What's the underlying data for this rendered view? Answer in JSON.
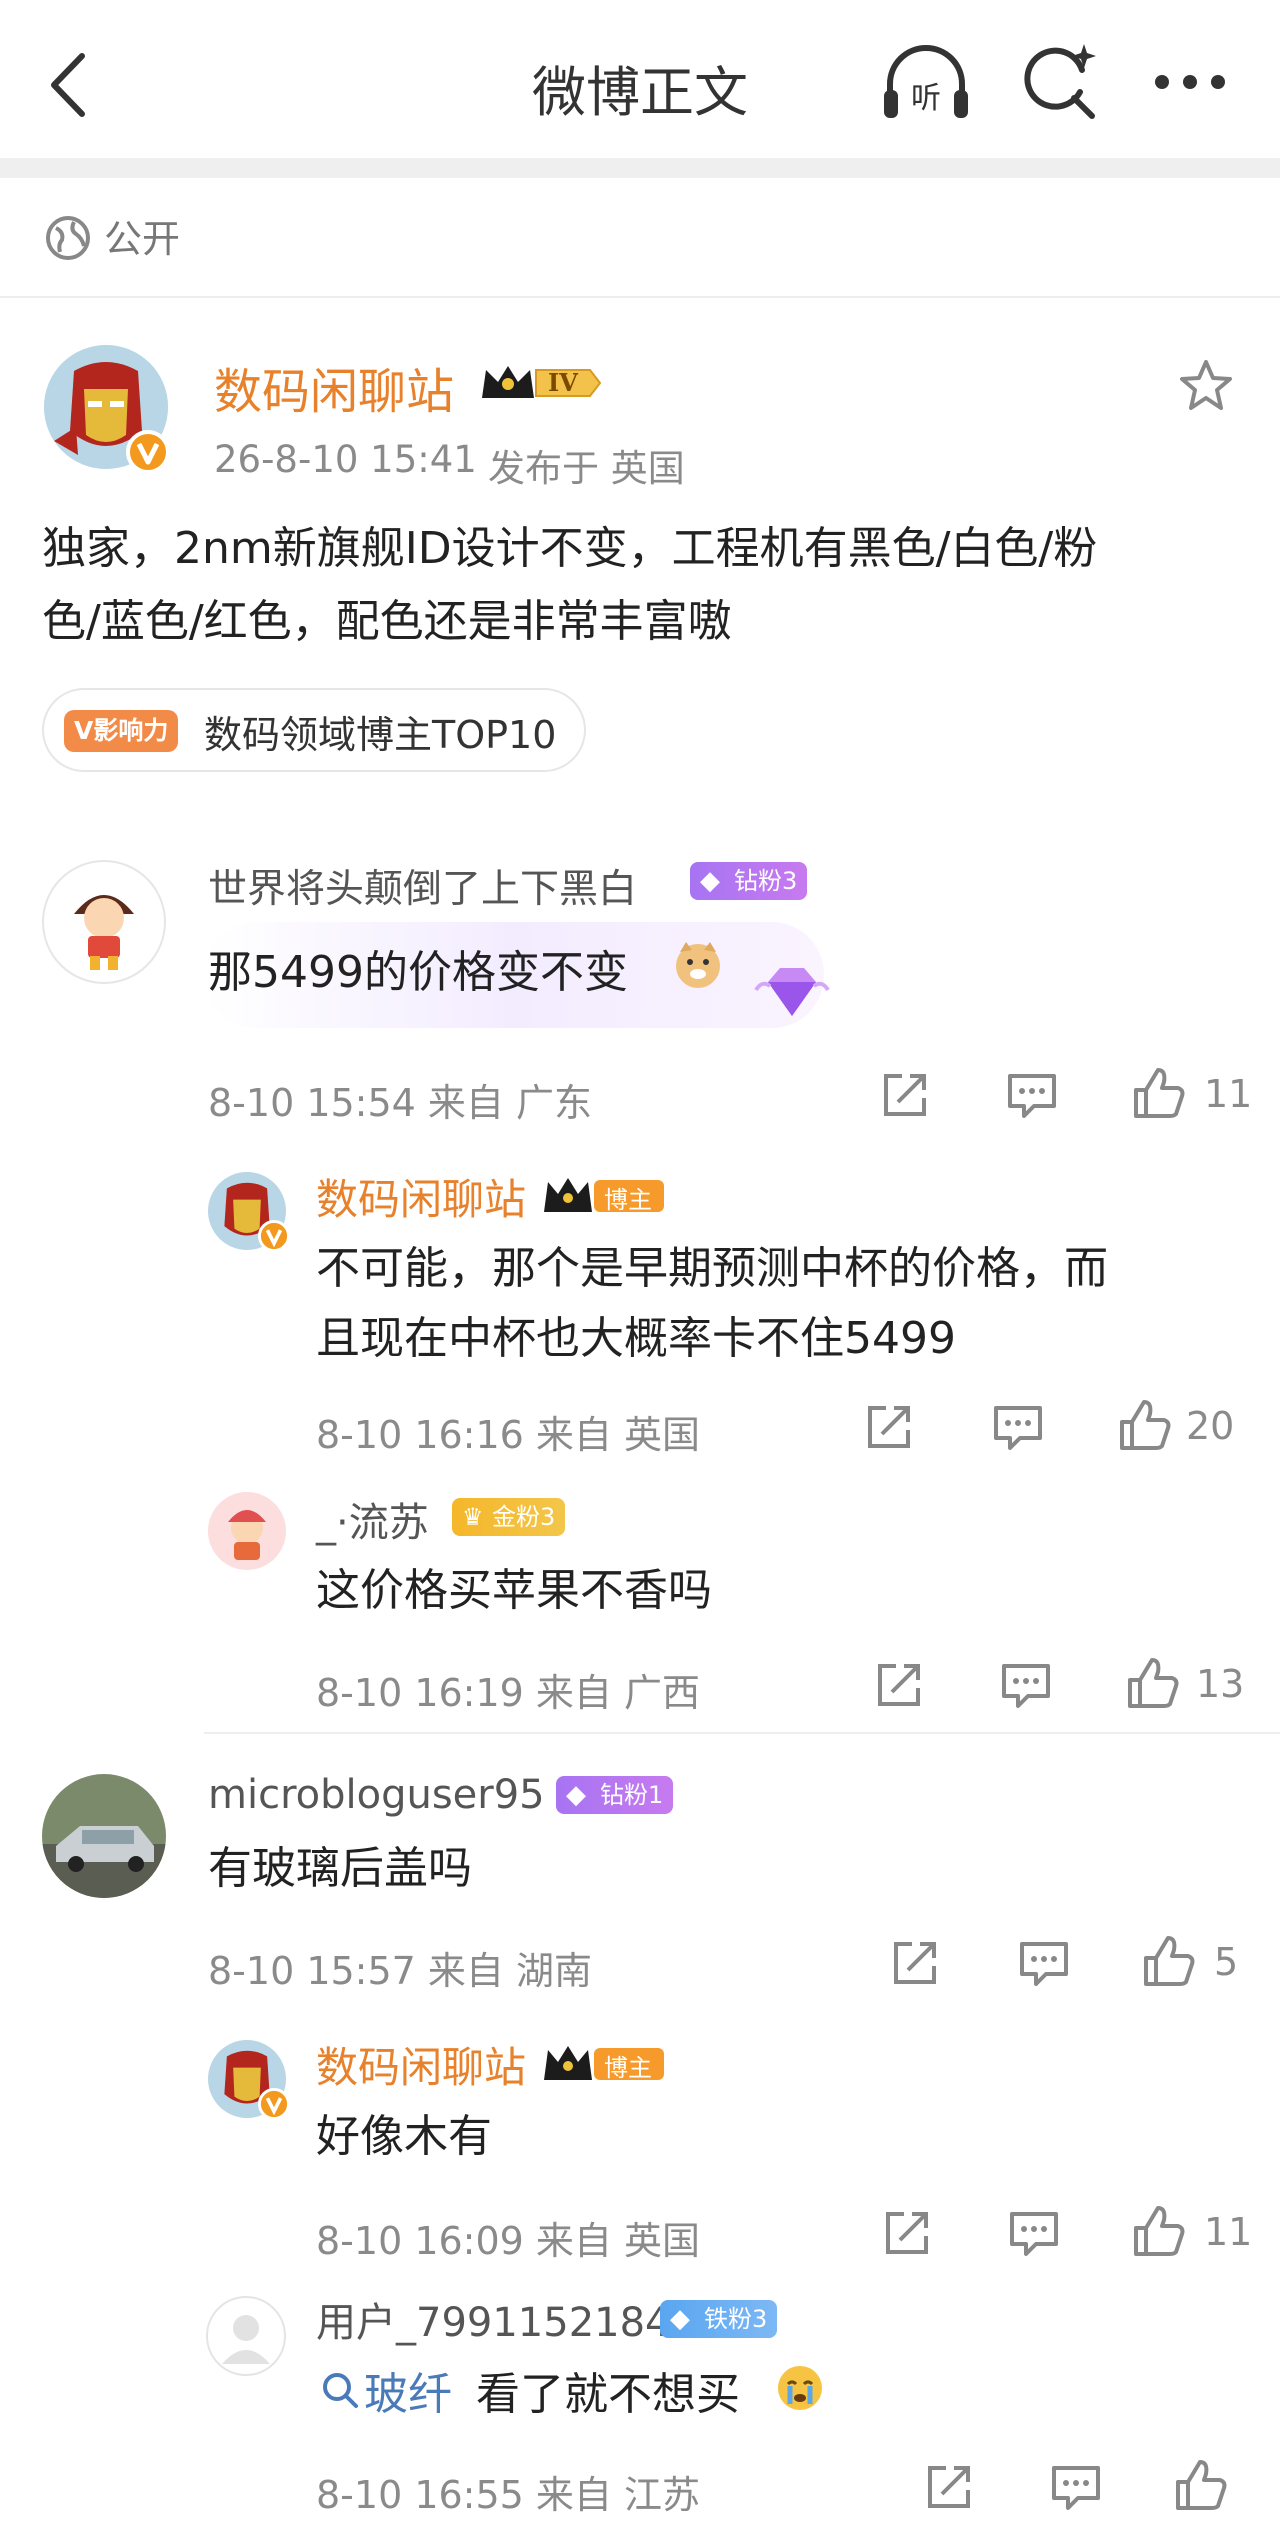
{
  "header": {
    "title": "微博正文"
  },
  "visibility": {
    "label": "公开"
  },
  "post": {
    "author": "数码闲聊站",
    "level_badge": "IV",
    "time": "26-8-10 15:41",
    "location": "发布于 英国",
    "content_line1": "独家，2nm新旗舰ID设计不变，工程机有黑色/白色/粉",
    "content_line2": "色/蓝色/红色，配色还是非常丰富嗷",
    "influence_badge": "V影响力",
    "influence_text": "数码领域博主TOP10"
  },
  "comments": [
    {
      "user": "世界将头颠倒了上下黑白",
      "badge": "钻粉3",
      "text": "那5499的价格变不变",
      "time": "8-10 15:54 来自 广东",
      "likes": "11"
    },
    {
      "user": "数码闲聊站",
      "badge": "博主",
      "text_line1": "不可能，那个是早期预测中杯的价格，而",
      "text_line2": "且现在中杯也大概率卡不住5499",
      "time": "8-10 16:16 来自 英国",
      "likes": "20"
    },
    {
      "user": "_·流苏",
      "badge": "金粉3",
      "text": "这价格买苹果不香吗",
      "time": "8-10 16:19 来自 广西",
      "likes": "13"
    },
    {
      "user": "microbloguser95",
      "badge": "钻粉1",
      "text": "有玻璃后盖吗",
      "time": "8-10 15:57 来自 湖南",
      "likes": "5"
    },
    {
      "user": "数码闲聊站",
      "badge": "博主",
      "text": "好像木有",
      "time": "8-10 16:09 来自 英国",
      "likes": "11"
    },
    {
      "user": "用户_7991152184",
      "badge": "铁粉3",
      "link": "玻纤",
      "text": "看了就不想买",
      "time": "8-10 16:55 来自 江苏",
      "likes": ""
    }
  ]
}
